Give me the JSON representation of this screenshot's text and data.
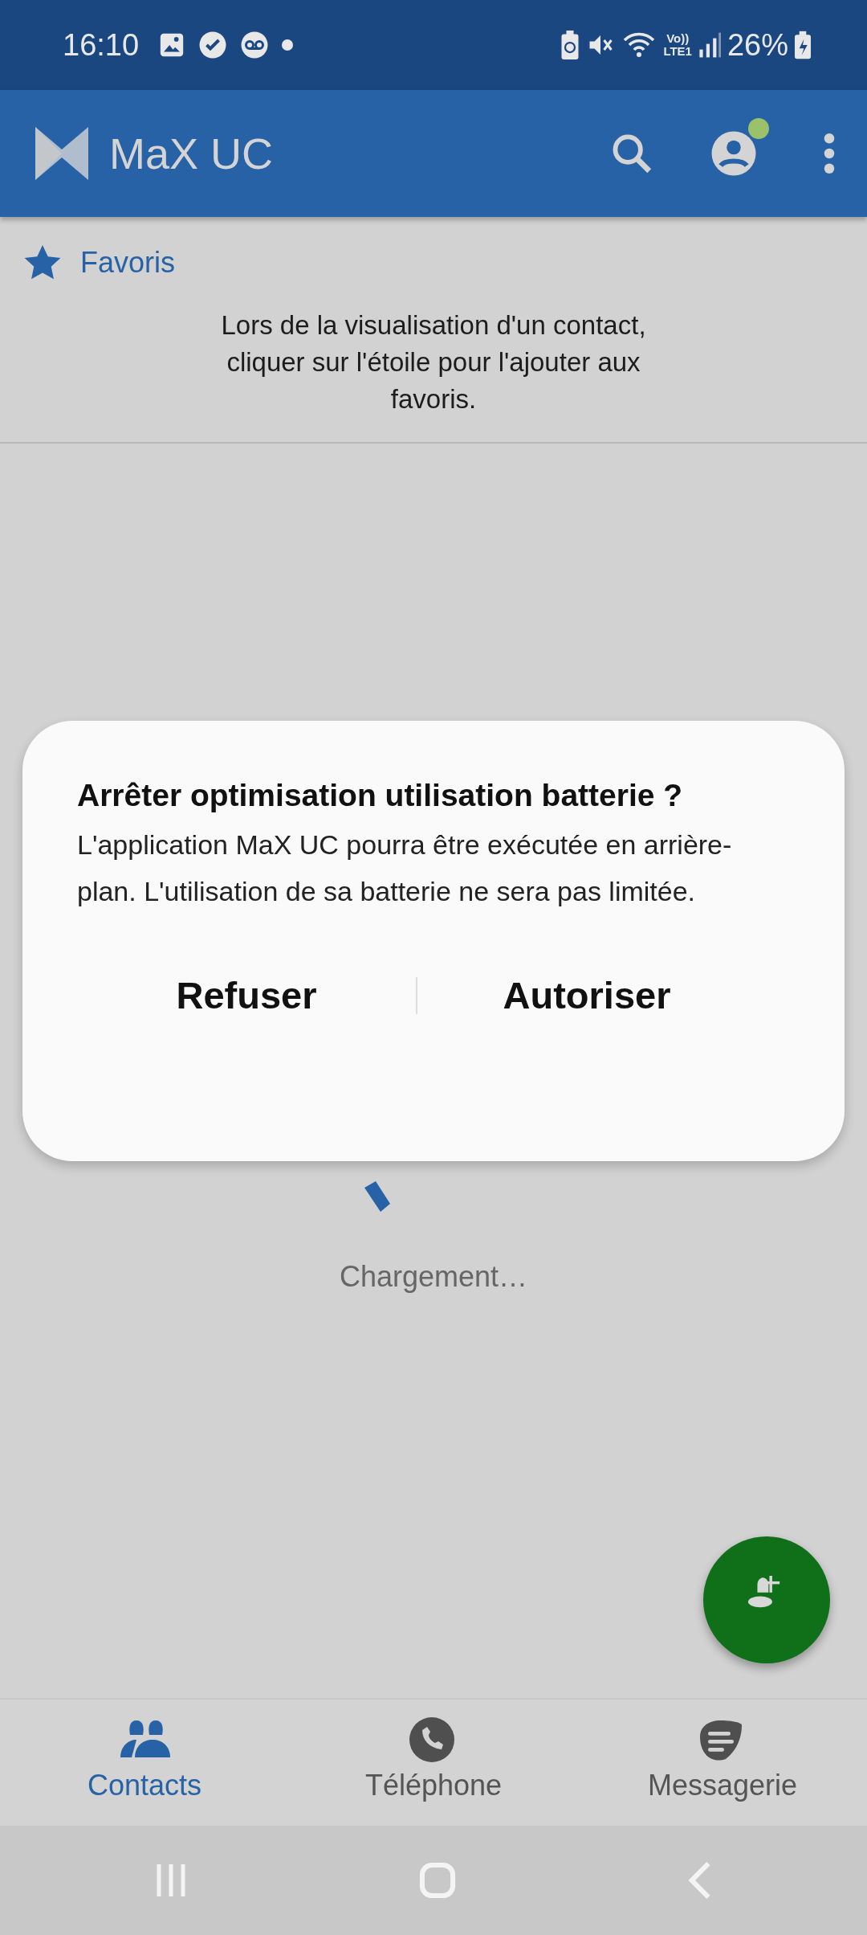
{
  "status_bar": {
    "time": "16:10",
    "volte": "Vo))",
    "network": "LTE1",
    "battery": "26%"
  },
  "app_bar": {
    "title": "MaX UC"
  },
  "favorites": {
    "title": "Favoris",
    "hint": "Lors de la visualisation d'un contact, cliquer sur l'étoile pour l'ajouter aux favoris."
  },
  "loading": {
    "text": "Chargement…"
  },
  "dialog": {
    "title": "Arrêter optimisation utilisation batterie ?",
    "message": "L'application MaX UC pourra être exécutée en arrière-plan. L'utilisation de sa batterie ne sera pas limitée.",
    "buttons": [
      "Refuser",
      "Autoriser"
    ]
  },
  "bottom_nav": [
    {
      "kind": "contacts",
      "label": "Contacts",
      "selected": true
    },
    {
      "kind": "phone",
      "label": "Téléphone",
      "selected": false
    },
    {
      "kind": "messages",
      "label": "Messagerie",
      "selected": false
    }
  ]
}
